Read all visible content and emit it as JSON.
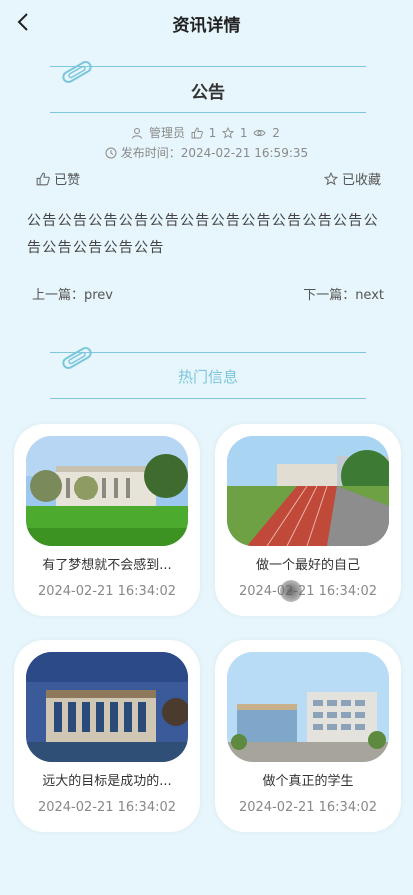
{
  "header": {
    "title": "资讯详情"
  },
  "notice": {
    "title": "公告",
    "author": "管理员",
    "likes": "1",
    "favorites": "1",
    "views": "2",
    "publish_time": "发布时间：2024-02-21 16:59:35",
    "liked_label": "已赞",
    "favorited_label": "已收藏",
    "content": "公告公告公告公告公告公告公告公告公告公告公告公告公告公告公告公告",
    "prev": "上一篇：prev",
    "next": "下一篇：next"
  },
  "hot": {
    "title": "热门信息",
    "items": [
      {
        "title": "有了梦想就不会感到...",
        "date": "2024-02-21 16:34:02"
      },
      {
        "title": "做一个最好的自己",
        "date": "2024-02-21 16:34:02"
      },
      {
        "title": "远大的目标是成功的...",
        "date": "2024-02-21 16:34:02"
      },
      {
        "title": "做个真正的学生",
        "date": "2024-02-21 16:34:02"
      }
    ]
  },
  "colors": {
    "background": "#e7f6fc",
    "accent": "#7cc6dc"
  }
}
